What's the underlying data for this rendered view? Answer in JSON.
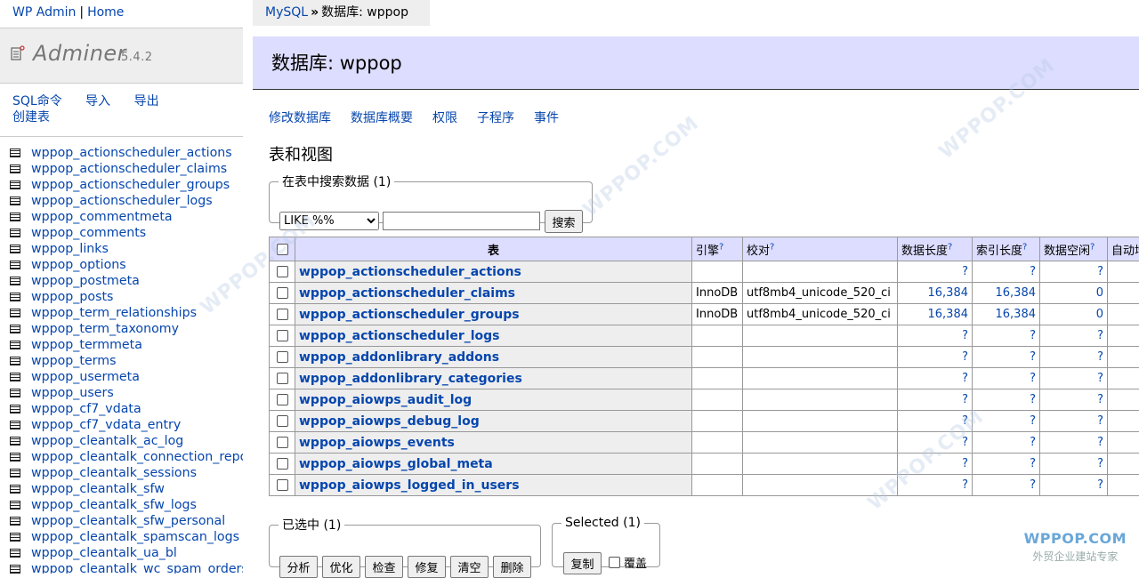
{
  "menu": {
    "top_links": [
      "WP Admin",
      "Home"
    ],
    "brand": "Adminer",
    "version": "5.4.2",
    "commands": [
      "SQL命令",
      "导入",
      "导出",
      "创建表"
    ],
    "tables": [
      "wppop_actionscheduler_actions",
      "wppop_actionscheduler_claims",
      "wppop_actionscheduler_groups",
      "wppop_actionscheduler_logs",
      "wppop_commentmeta",
      "wppop_comments",
      "wppop_links",
      "wppop_options",
      "wppop_postmeta",
      "wppop_posts",
      "wppop_term_relationships",
      "wppop_term_taxonomy",
      "wppop_termmeta",
      "wppop_terms",
      "wppop_usermeta",
      "wppop_users",
      "wppop_cf7_vdata",
      "wppop_cf7_vdata_entry",
      "wppop_cleantalk_ac_log",
      "wppop_cleantalk_connection_reports",
      "wppop_cleantalk_sessions",
      "wppop_cleantalk_sfw",
      "wppop_cleantalk_sfw_logs",
      "wppop_cleantalk_sfw_personal",
      "wppop_cleantalk_spamscan_logs",
      "wppop_cleantalk_ua_bl",
      "wppop_cleantalk_wc_spam_orders"
    ]
  },
  "breadcrumb": {
    "root": "MySQL",
    "arrow": "»",
    "current": "数据库: wppop"
  },
  "header": {
    "title": "数据库: wppop"
  },
  "links": [
    "修改数据库",
    "数据库概要",
    "权限",
    "子程序",
    "事件"
  ],
  "section_title": "表和视图",
  "search": {
    "legend": "在表中搜索数据 (1)",
    "operator": "LIKE %%",
    "value": "",
    "button": "搜索"
  },
  "table": {
    "headers": {
      "name": "表",
      "engine": "引擎",
      "collation": "校对",
      "data_length": "数据长度",
      "index_length": "索引长度",
      "data_free": "数据空闲",
      "auto_increment": "自动增量"
    },
    "help_mark": "?",
    "rows": [
      {
        "name": "wppop_actionscheduler_actions",
        "engine": "",
        "collation": "",
        "data_length": "?",
        "index_length": "?",
        "data_free": "?"
      },
      {
        "name": "wppop_actionscheduler_claims",
        "engine": "InnoDB",
        "collation": "utf8mb4_unicode_520_ci",
        "data_length": "16,384",
        "index_length": "16,384",
        "data_free": "0"
      },
      {
        "name": "wppop_actionscheduler_groups",
        "engine": "InnoDB",
        "collation": "utf8mb4_unicode_520_ci",
        "data_length": "16,384",
        "index_length": "16,384",
        "data_free": "0"
      },
      {
        "name": "wppop_actionscheduler_logs",
        "engine": "",
        "collation": "",
        "data_length": "?",
        "index_length": "?",
        "data_free": "?"
      },
      {
        "name": "wppop_addonlibrary_addons",
        "engine": "",
        "collation": "",
        "data_length": "?",
        "index_length": "?",
        "data_free": "?"
      },
      {
        "name": "wppop_addonlibrary_categories",
        "engine": "",
        "collation": "",
        "data_length": "?",
        "index_length": "?",
        "data_free": "?"
      },
      {
        "name": "wppop_aiowps_audit_log",
        "engine": "",
        "collation": "",
        "data_length": "?",
        "index_length": "?",
        "data_free": "?"
      },
      {
        "name": "wppop_aiowps_debug_log",
        "engine": "",
        "collation": "",
        "data_length": "?",
        "index_length": "?",
        "data_free": "?"
      },
      {
        "name": "wppop_aiowps_events",
        "engine": "",
        "collation": "",
        "data_length": "?",
        "index_length": "?",
        "data_free": "?"
      },
      {
        "name": "wppop_aiowps_global_meta",
        "engine": "",
        "collation": "",
        "data_length": "?",
        "index_length": "?",
        "data_free": "?"
      },
      {
        "name": "wppop_aiowps_logged_in_users",
        "engine": "",
        "collation": "",
        "data_length": "?",
        "index_length": "?",
        "data_free": "?"
      }
    ]
  },
  "selected_cn": {
    "legend": "已选中 (1)",
    "buttons": [
      "分析",
      "优化",
      "检查",
      "修复",
      "清空",
      "删除"
    ]
  },
  "selected_en": {
    "legend": "Selected (1)",
    "copy_button": "复制",
    "overwrite_label": "覆盖"
  },
  "watermark": {
    "text": "WPPOP.COM",
    "subtitle": "外贸企业建站专家"
  }
}
